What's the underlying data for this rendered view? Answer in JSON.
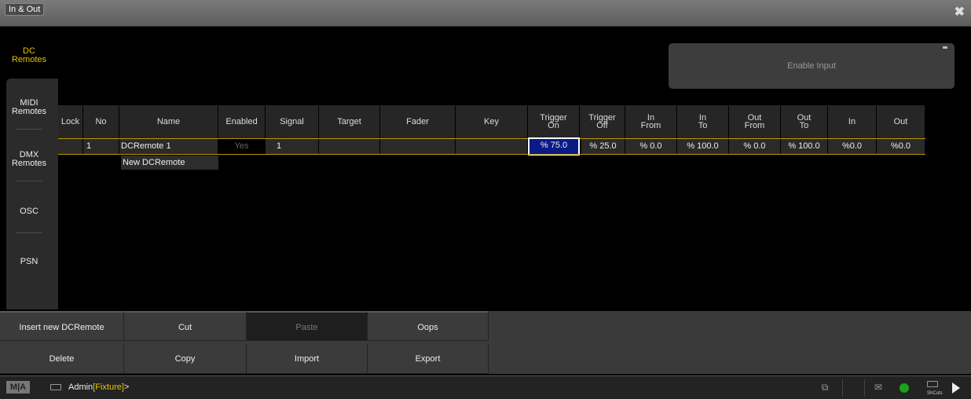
{
  "window": {
    "title": "In & Out",
    "close_icon": "close-icon"
  },
  "sidebar": {
    "items": [
      {
        "label": "DC\nRemotes",
        "active": true
      },
      {
        "label": "MIDI\nRemotes",
        "active": false
      },
      {
        "label": "DMX\nRemotes",
        "active": false
      },
      {
        "label": "OSC",
        "active": false
      },
      {
        "label": "PSN",
        "active": false
      }
    ]
  },
  "enable_input": {
    "label": "Enable Input"
  },
  "table": {
    "columns": [
      "Lock",
      "No",
      "Name",
      "Enabled",
      "Signal",
      "Target",
      "Fader",
      "Key",
      "Trigger\nOn",
      "Trigger\nOff",
      "In\nFrom",
      "In\nTo",
      "Out\nFrom",
      "Out\nTo",
      "In",
      "Out"
    ],
    "rows": [
      {
        "lock": "",
        "no": "1",
        "name": "DCRemote 1",
        "enabled": "Yes",
        "signal": "1",
        "target": "",
        "fader": "",
        "key": "",
        "trigger_on": "% 75.0",
        "trigger_off": "% 25.0",
        "in_from": "% 0.0",
        "in_to": "% 100.0",
        "out_from": "% 0.0",
        "out_to": "% 100.0",
        "in": "%0.0",
        "out": "%0.0"
      }
    ],
    "new_row": "New DCRemote"
  },
  "buttons": {
    "insert": "Insert new DCRemote",
    "cut": "Cut",
    "paste": "Paste",
    "oops": "Oops",
    "delete": "Delete",
    "copy": "Copy",
    "import": "Import",
    "export": "Export"
  },
  "statusbar": {
    "logo": "M|A",
    "user": "Admin",
    "context": "[Fixture]",
    "prompt": ">",
    "shortcuts": "ShCuts"
  },
  "colors": {
    "accent": "#e7c300",
    "selection": "#0a1b86",
    "status_green": "#1aa31a"
  }
}
